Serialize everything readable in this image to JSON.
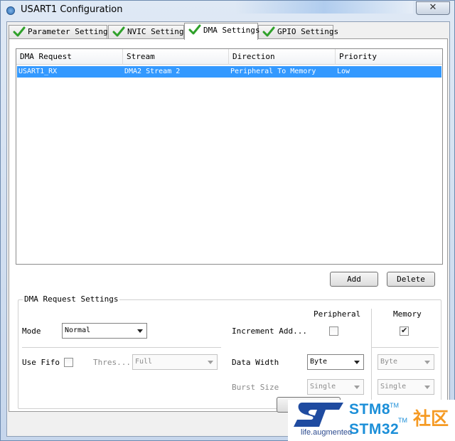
{
  "window": {
    "title": "USART1 Configuration",
    "close_glyph": "✕"
  },
  "tabs": [
    {
      "label": "Parameter Settings",
      "icon": "check-icon"
    },
    {
      "label": "NVIC Settings",
      "icon": "check-icon"
    },
    {
      "label": "DMA Settings",
      "icon": "check-icon",
      "active": true
    },
    {
      "label": "GPIO Settings",
      "icon": "check-icon"
    }
  ],
  "dma_table": {
    "columns": [
      "DMA Request",
      "Stream",
      "Direction",
      "Priority"
    ],
    "rows": [
      {
        "request": "USART1_RX",
        "stream": "DMA2 Stream 2",
        "direction": "Peripheral To Memory",
        "priority": "Low",
        "selected": true
      }
    ]
  },
  "buttons": {
    "add": "Add",
    "delete": "Delete"
  },
  "settings": {
    "title": "DMA Request Settings",
    "peripheral_header": "Peripheral",
    "memory_header": "Memory",
    "mode_label": "Mode",
    "mode_value": "Normal",
    "increment_label": "Increment Add...",
    "increment_peripheral_checked": false,
    "increment_memory_checked": true,
    "use_fifo_label": "Use Fifo",
    "use_fifo_checked": false,
    "threshold_label": "Thres...",
    "threshold_value": "Full",
    "data_width_label": "Data Width",
    "data_width_peripheral": "Byte",
    "data_width_memory": "Byte",
    "burst_size_label": "Burst Size",
    "burst_size_peripheral": "Single",
    "burst_size_memory": "Single"
  },
  "watermark": {
    "tagline": "life.augmented",
    "line1": "STM8",
    "line2": "STM32",
    "tm": "TM",
    "cn": "社区"
  },
  "colors": {
    "selection": "#3399ff",
    "check_green": "#2fa12a",
    "st_blue": "#1c8fd8",
    "cn_orange": "#f59a23"
  }
}
